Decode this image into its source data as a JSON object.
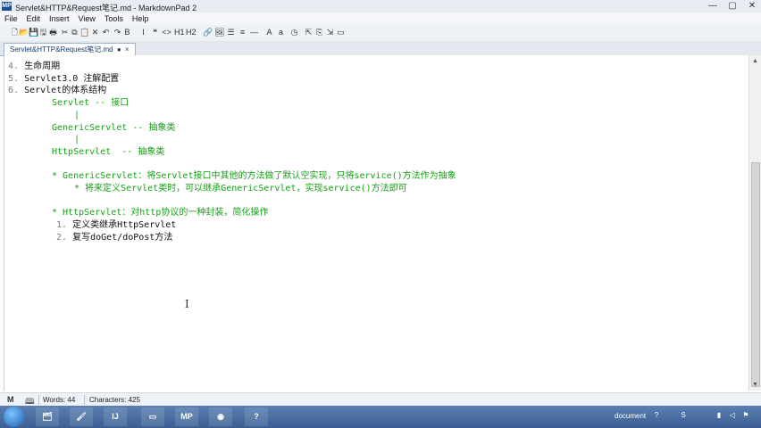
{
  "window": {
    "title": "Servlet&HTTP&Request笔记.md - MarkdownPad 2",
    "app_icon": "MP",
    "buttons": [
      "minimize-icon",
      "maximize-icon",
      "close-icon"
    ]
  },
  "menu": [
    "File",
    "Edit",
    "Insert",
    "View",
    "Tools",
    "Help"
  ],
  "toolbar": {
    "icons": [
      {
        "name": "new-file-icon",
        "glyph": "🗋"
      },
      {
        "name": "open-folder-icon",
        "glyph": "📂"
      },
      {
        "name": "save-icon",
        "glyph": "💾"
      },
      {
        "name": "save-all-icon",
        "glyph": "🖫"
      },
      {
        "name": "print-icon",
        "glyph": "🖶"
      },
      {
        "name": "cut-icon",
        "glyph": "✂"
      },
      {
        "name": "copy-icon",
        "glyph": "⧉"
      },
      {
        "name": "paste-icon",
        "glyph": "📋"
      },
      {
        "name": "delete-icon",
        "glyph": "✕"
      },
      {
        "name": "undo-icon",
        "glyph": "↶"
      },
      {
        "name": "redo-icon",
        "glyph": "↷"
      },
      {
        "name": "bold-icon",
        "glyph": "B"
      },
      {
        "name": "italic-icon",
        "glyph": "I"
      },
      {
        "name": "quote-icon",
        "glyph": "❝"
      },
      {
        "name": "code-icon",
        "glyph": "<>"
      },
      {
        "name": "heading1-icon",
        "glyph": "H1"
      },
      {
        "name": "heading2-icon",
        "glyph": "H2"
      },
      {
        "name": "link-icon",
        "glyph": "🔗"
      },
      {
        "name": "image-icon",
        "glyph": "🖼"
      },
      {
        "name": "bullet-list-icon",
        "glyph": "☰"
      },
      {
        "name": "numbered-list-icon",
        "glyph": "≡"
      },
      {
        "name": "horizontal-rule-icon",
        "glyph": "—"
      },
      {
        "name": "uppercase-icon",
        "glyph": "A"
      },
      {
        "name": "lowercase-icon",
        "glyph": "a"
      },
      {
        "name": "timestamp-icon",
        "glyph": "◷"
      },
      {
        "name": "preview-toggle-icon",
        "glyph": "⇱"
      },
      {
        "name": "live-preview-icon",
        "glyph": "⎘"
      },
      {
        "name": "export-icon",
        "glyph": "⇲"
      },
      {
        "name": "options-icon",
        "glyph": "▭"
      }
    ]
  },
  "tab": {
    "label": "Servlet&HTTP&Request笔记.md",
    "modified_marker": "●",
    "close": "×"
  },
  "editor": {
    "lines": [
      {
        "num": "4.",
        "text": "生命周期",
        "color": "dark",
        "indent": 0
      },
      {
        "num": "5.",
        "text": "Servlet3.0 注解配置",
        "color": "dark",
        "indent": 0
      },
      {
        "num": "6.",
        "text": "Servlet的体系结构",
        "color": "dark",
        "indent": 0
      },
      {
        "num": "",
        "text": "Servlet -- 接口",
        "color": "green",
        "indent": 1
      },
      {
        "num": "",
        "text": "|",
        "color": "green",
        "indent": 2
      },
      {
        "num": "",
        "text": "GenericServlet -- 抽象类",
        "color": "green",
        "indent": 1
      },
      {
        "num": "",
        "text": "|",
        "color": "green",
        "indent": 2
      },
      {
        "num": "",
        "text": "HttpServlet  -- 抽象类",
        "color": "green",
        "indent": 1
      },
      {
        "num": "",
        "text": "",
        "color": "green",
        "indent": 1
      },
      {
        "num": "",
        "text": "* GenericServlet：将Servlet接口中其他的方法做了默认空实现，只将service()方法作为抽象",
        "color": "green",
        "indent": 1
      },
      {
        "num": "",
        "text": "* 将来定义Servlet类时，可以继承GenericServlet，实现service()方法即可",
        "color": "green",
        "indent": 3
      },
      {
        "num": "",
        "text": "",
        "color": "green",
        "indent": 1
      },
      {
        "num": "",
        "text": "* HttpServlet：对http协议的一种封装，简化操作",
        "color": "green",
        "indent": 1
      },
      {
        "num": "1.",
        "text": "定义类继承HttpServlet",
        "color": "dark",
        "indent": 3
      },
      {
        "num": "2.",
        "text": "复写doGet/doPost方法",
        "color": "dark",
        "indent": 3
      }
    ]
  },
  "status": {
    "mode_icon": "M",
    "words_label": "Words: 44",
    "chars_label": "Characters: 425"
  },
  "taskbar": {
    "apps": [
      {
        "name": "taskbar-folder-icon",
        "glyph": "🗂"
      },
      {
        "name": "taskbar-brush-icon",
        "glyph": "🖌"
      },
      {
        "name": "taskbar-intellij-icon",
        "glyph": "IJ"
      },
      {
        "name": "taskbar-window-icon",
        "glyph": "▭"
      },
      {
        "name": "taskbar-explorer-icon",
        "glyph": "📁"
      },
      {
        "name": "taskbar-markdownpad-icon",
        "glyph": "MP"
      },
      {
        "name": "taskbar-chrome-icon",
        "glyph": "◉"
      },
      {
        "name": "taskbar-help-icon",
        "glyph": "?"
      }
    ],
    "tray_text": "document"
  }
}
